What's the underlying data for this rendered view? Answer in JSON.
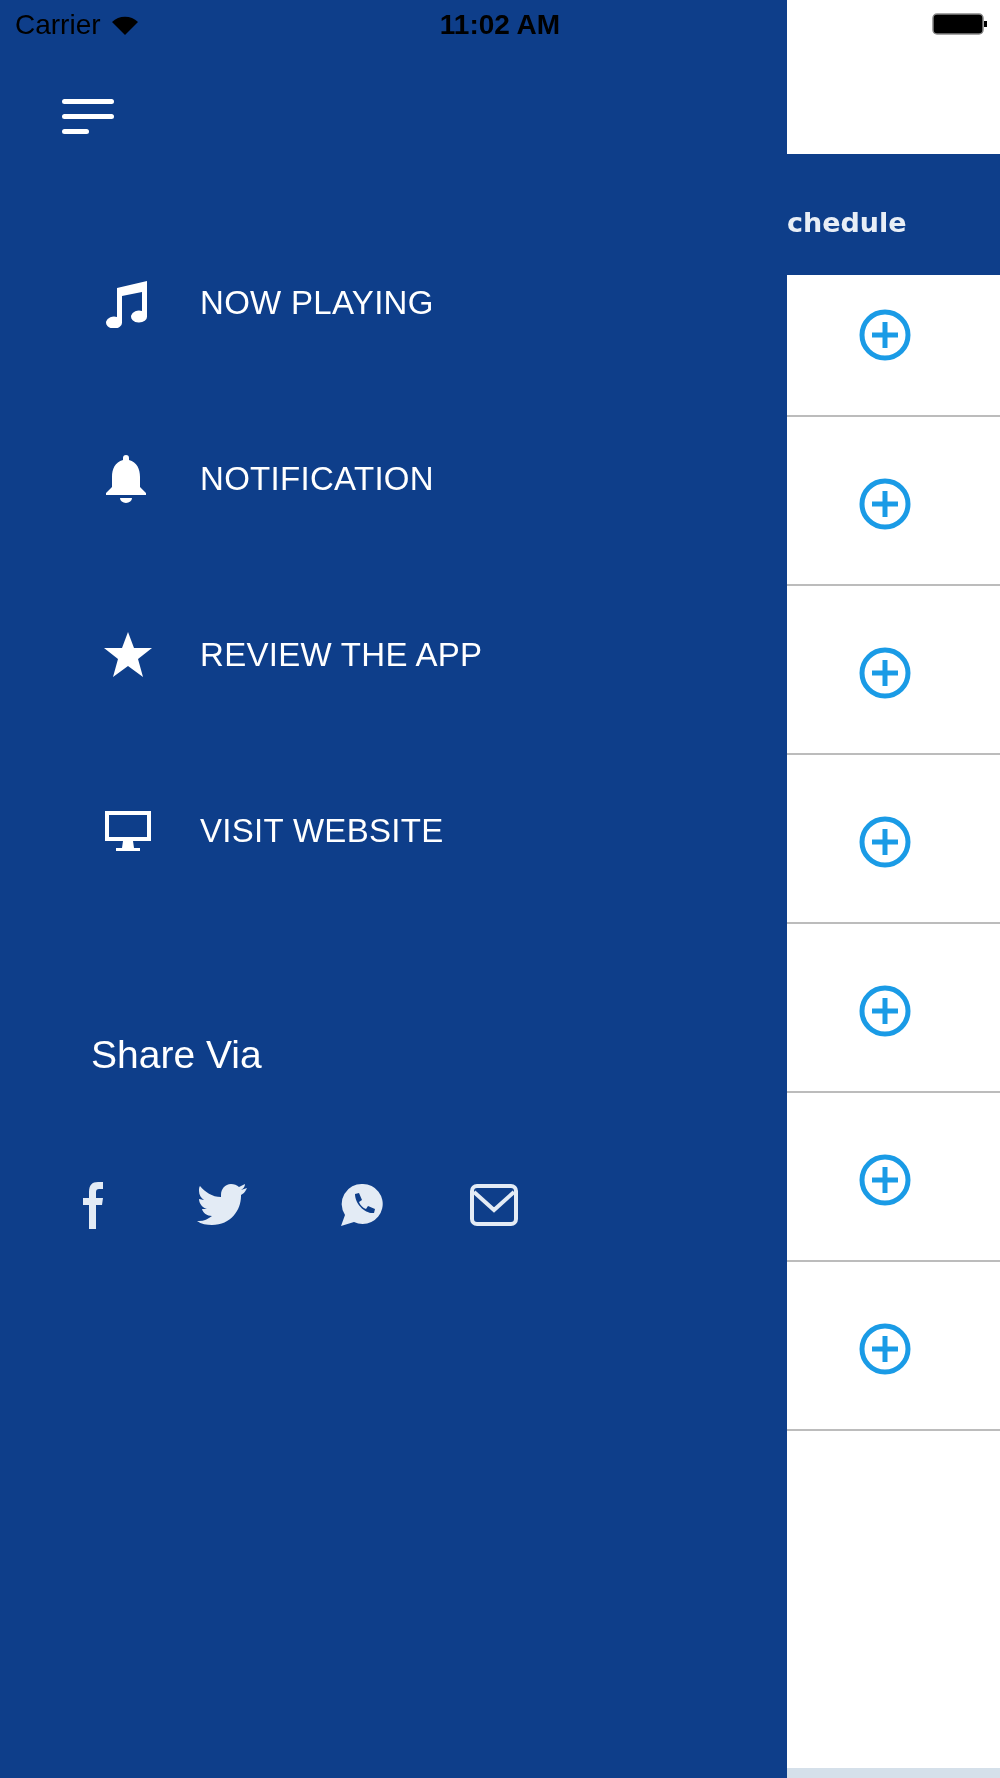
{
  "status_bar": {
    "carrier": "Carrier",
    "time": "11:02 AM"
  },
  "drawer": {
    "menu": [
      {
        "label": "NOW PLAYING",
        "kind": "music"
      },
      {
        "label": "NOTIFICATION",
        "kind": "bell"
      },
      {
        "label": "REVIEW THE APP",
        "kind": "star"
      },
      {
        "label": "VISIT WEBSITE",
        "kind": "monitor"
      }
    ],
    "share_title": "Share Via",
    "share": [
      {
        "kind": "facebook"
      },
      {
        "kind": "twitter"
      },
      {
        "kind": "whatsapp"
      },
      {
        "kind": "mail"
      }
    ]
  },
  "background_screen": {
    "tab": "chedule",
    "rows": [
      {
        "kind": "add"
      },
      {
        "kind": "add"
      },
      {
        "kind": "add"
      },
      {
        "kind": "add"
      },
      {
        "kind": "add"
      },
      {
        "kind": "add"
      },
      {
        "kind": "add"
      }
    ]
  }
}
